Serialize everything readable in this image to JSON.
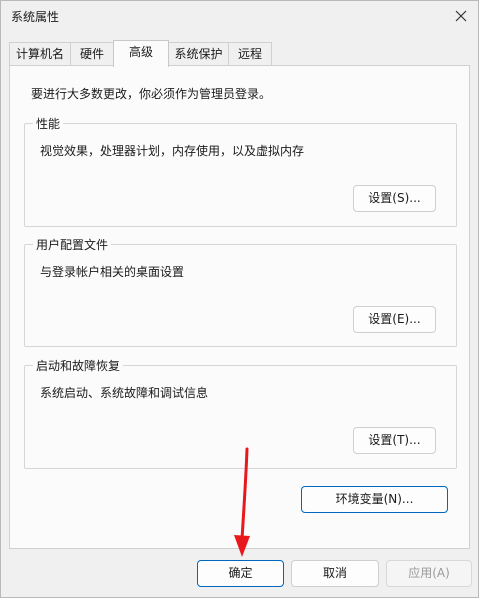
{
  "window": {
    "title": "系统属性",
    "close_icon": "close-icon"
  },
  "tabs": [
    {
      "label": "计算机名",
      "active": false
    },
    {
      "label": "硬件",
      "active": false
    },
    {
      "label": "高级",
      "active": true
    },
    {
      "label": "系统保护",
      "active": false
    },
    {
      "label": "远程",
      "active": false
    }
  ],
  "advanced": {
    "intro": "要进行大多数更改，你必须作为管理员登录。",
    "performance": {
      "title": "性能",
      "description": "视觉效果，处理器计划，内存使用，以及虚拟内存",
      "button": "设置(S)..."
    },
    "user_profiles": {
      "title": "用户配置文件",
      "description": "与登录帐户相关的桌面设置",
      "button": "设置(E)..."
    },
    "startup_recovery": {
      "title": "启动和故障恢复",
      "description": "系统启动、系统故障和调试信息",
      "button": "设置(T)..."
    },
    "env_button": "环境变量(N)..."
  },
  "footer": {
    "ok": "确定",
    "cancel": "取消",
    "apply": "应用(A)"
  },
  "colors": {
    "accent": "#0067c0",
    "annotation_arrow": "#e8191c"
  }
}
